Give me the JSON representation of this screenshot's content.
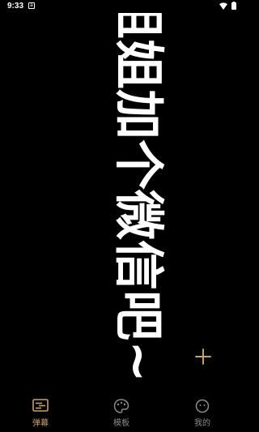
{
  "status_bar": {
    "time": "9:33",
    "app_badge": "a"
  },
  "danmaku": {
    "text": "姐姐加个微信吧~",
    "color": "#ffffff",
    "background": "#000000"
  },
  "fab": {
    "icon": "plus-icon",
    "color": "#c9a167"
  },
  "nav": {
    "items": [
      {
        "label": "弹幕",
        "icon": "danmaku-icon",
        "active": true
      },
      {
        "label": "模板",
        "icon": "palette-icon",
        "active": false
      },
      {
        "label": "我的",
        "icon": "profile-face-icon",
        "active": false
      }
    ],
    "active_color": "#c9a167",
    "inactive_color": "#8a8a8a"
  }
}
